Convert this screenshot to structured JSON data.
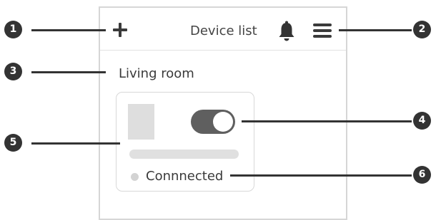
{
  "header": {
    "title": "Device list",
    "add_icon": "plus-icon",
    "notification_icon": "bell-icon",
    "menu_icon": "hamburger-menu-icon"
  },
  "room": {
    "name": "Living room"
  },
  "device_card": {
    "toggle_state": "on",
    "status": "Connnected"
  },
  "callouts": [
    "1",
    "2",
    "3",
    "4",
    "5",
    "6"
  ]
}
